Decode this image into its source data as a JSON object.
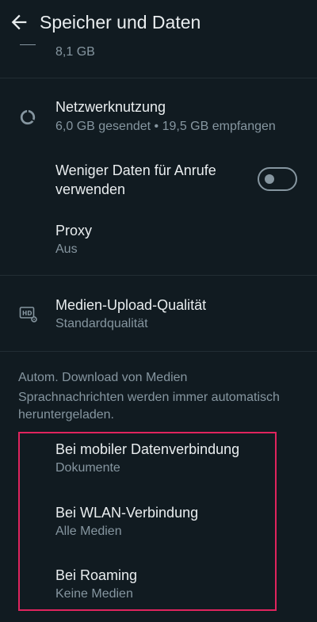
{
  "header": {
    "title": "Speicher und Daten"
  },
  "partial_row": {
    "subtitle": "8,1 GB"
  },
  "network_usage": {
    "title": "Netzwerknutzung",
    "subtitle": "6,0 GB gesendet • 19,5 GB empfangen"
  },
  "low_data_calls": {
    "title_line1": "Weniger Daten für Anrufe",
    "title_line2": "verwenden",
    "enabled": false
  },
  "proxy": {
    "title": "Proxy",
    "subtitle": "Aus"
  },
  "media_upload": {
    "title": "Medien-Upload-Qualität",
    "subtitle": "Standardqualität"
  },
  "auto_download": {
    "header": "Autom. Download von Medien",
    "note": "Sprachnachrichten werden immer automatisch heruntergeladen.",
    "items": [
      {
        "title": "Bei mobiler Datenverbindung",
        "subtitle": "Dokumente"
      },
      {
        "title": "Bei WLAN-Verbindung",
        "subtitle": "Alle Medien"
      },
      {
        "title": "Bei Roaming",
        "subtitle": "Keine Medien"
      }
    ]
  },
  "colors": {
    "background": "#111B21",
    "primary_text": "#E9EDEF",
    "secondary_text": "#8696A0",
    "highlight": "#E0245E"
  }
}
